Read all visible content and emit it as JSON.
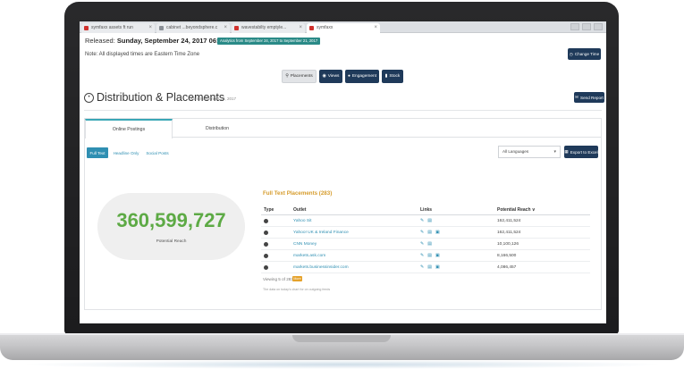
{
  "browser": {
    "tabs": [
      {
        "label": "symfaxx assets ft run"
      },
      {
        "label": "cabinet ...beyondsphere.c"
      },
      {
        "label": "wavestabilty emptyle..."
      },
      {
        "label": "symfaxx"
      }
    ]
  },
  "header": {
    "released_prefix": "Released: ",
    "released_date": "Sunday, September 24, 2017 06:00 AM EST",
    "analytics_badge": "Analytics from September 24, 2017 to September 21, 2017",
    "note": "Note: All displayed times are Eastern Time Zone",
    "change_time_label": "Change Time"
  },
  "nav": {
    "items": [
      {
        "label": "Placements",
        "current": true
      },
      {
        "label": "Views",
        "current": false
      },
      {
        "label": "Engagement",
        "current": false
      },
      {
        "label": "Stock",
        "current": false
      }
    ]
  },
  "page": {
    "title": "Distribution & Placements",
    "subtitle": "from September 24, 2017",
    "send_report_label": "Send Report"
  },
  "panel": {
    "tabs": [
      {
        "label": "Online Postings",
        "active": true
      },
      {
        "label": "Distribution",
        "active": false
      }
    ],
    "filters": [
      {
        "label": "Full Text",
        "active": true
      },
      {
        "label": "Headline Only",
        "active": false
      },
      {
        "label": "Social Posts",
        "active": false
      }
    ],
    "language_select": "All Languages",
    "export_label": "Export to Excel",
    "potential_reach_value": "360,599,727",
    "potential_reach_label": "Potential Reach",
    "placements_title": "Full Text Placements (283)",
    "columns": {
      "type": "Type",
      "outlet": "Outlet",
      "links": "Links",
      "reach": "Potential Reach ∨"
    },
    "rows": [
      {
        "outlet": "Yahoo Sit",
        "reach": "162,411,524",
        "links": 2
      },
      {
        "outlet": "Yahoo! UK & Ireland Finance",
        "reach": "162,411,524",
        "links": 3
      },
      {
        "outlet": "CNN Money",
        "reach": "10,100,126",
        "links": 2
      },
      {
        "outlet": "markets.ask.com",
        "reach": "8,166,500",
        "links": 3
      },
      {
        "outlet": "markets.businessinsider.com",
        "reach": "4,086,457",
        "links": 3
      }
    ],
    "viewing_text": "Viewing 5 of 283",
    "more_label": "More",
    "footnote": "The data on today's chart for on outgoing feeds"
  },
  "colors": {
    "brand_dark": "#1f3a5a",
    "accent_teal": "#2a8a87",
    "reach_green": "#5daa45",
    "placements_orange": "#d69c2c",
    "link_blue": "#2f8fb2"
  },
  "icons": {
    "tab_favicon": "document-icon",
    "change_time": "clock-icon",
    "placements": "map-pin-icon",
    "views": "eye-icon",
    "engagement": "chat-bubble-icon",
    "stock": "bar-chart-icon",
    "title": "pin-circle-icon",
    "send_report": "envelope-icon",
    "export": "table-icon",
    "link_edit": "pencil-icon",
    "link_doc": "document-icon",
    "link_save": "save-icon",
    "type_marker": "dot-icon"
  }
}
